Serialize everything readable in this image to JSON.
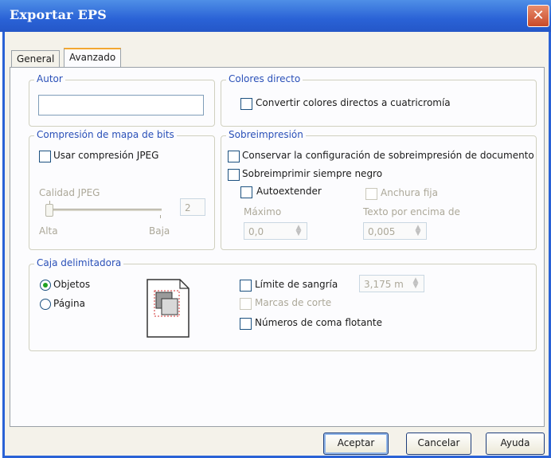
{
  "window": {
    "title": "Exportar EPS",
    "close_symbol": "✕"
  },
  "tabs": [
    {
      "label": "General"
    },
    {
      "label": "Avanzado"
    }
  ],
  "author": {
    "group_title": "Autor",
    "value": ""
  },
  "spot_colors": {
    "group_title": "Colores directo",
    "convert_label": "Convertir colores directos a cuatricromía",
    "convert_checked": false
  },
  "bitmap": {
    "group_title": "Compresión de mapa de bits",
    "use_jpeg_label": "Usar compresión JPEG",
    "use_jpeg_checked": false,
    "quality_label": "Calidad JPEG",
    "quality_value": "2",
    "high_label": "Alta",
    "low_label": "Baja"
  },
  "overprint": {
    "group_title": "Sobreimpresión",
    "keep_doc_label": "Conservar la configuración de sobreimpresión de documento",
    "always_black_label": "Sobreimprimir siempre negro",
    "auto_extend_label": "Autoextender",
    "fixed_width_label": "Anchura fija",
    "max_label": "Máximo",
    "max_value": "0,0",
    "text_above_label": "Texto por encima de",
    "text_above_value": "0,005"
  },
  "bounding_box": {
    "group_title": "Caja delimitadora",
    "objects_label": "Objetos",
    "objects_selected": true,
    "page_label": "Página",
    "bleed_label": "Límite de sangría",
    "bleed_value": "3,175 m",
    "crop_marks_label": "Marcas de corte",
    "floating_label": "Números de coma flotante"
  },
  "buttons": {
    "ok": "Aceptar",
    "cancel": "Cancelar",
    "help": "Ayuda"
  },
  "colors": {
    "title_bar": "#2a62d6",
    "group_title": "#2a50b8",
    "active_tab": "#f3a832",
    "close": "#c84a2a",
    "radio_dot": "#21a121"
  }
}
